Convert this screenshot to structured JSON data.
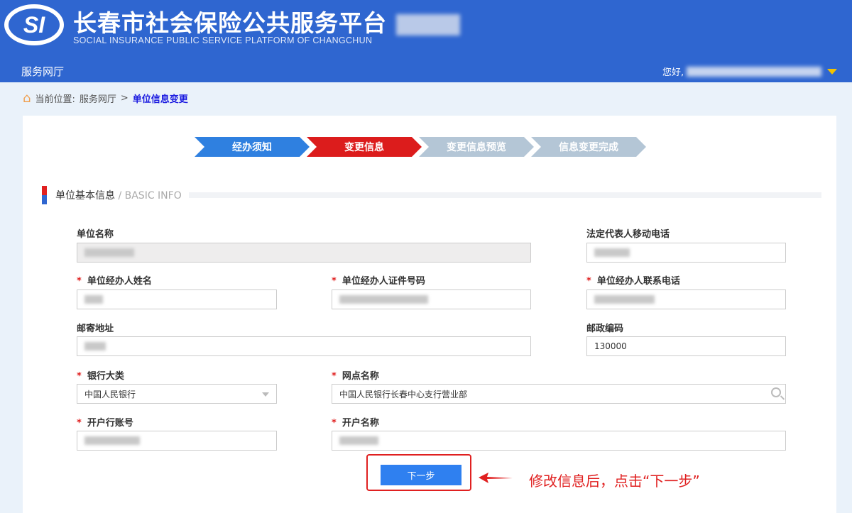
{
  "header": {
    "logo": "SI",
    "title": "长春市社会保险公共服务平台",
    "subtitle": "SOCIAL INSURANCE PUBLIC SERVICE PLATFORM OF CHANGCHUN",
    "nav_home": "服务网厅",
    "greeting": "您好,"
  },
  "breadcrumb": {
    "prefix": "当前位置:",
    "parent": "服务网厅",
    "separator": ">",
    "current": "单位信息变更"
  },
  "steps": [
    {
      "label": "经办须知",
      "color": "#2f80e0"
    },
    {
      "label": "变更信息",
      "color": "#dc1c1c"
    },
    {
      "label": "变更信息预览",
      "color": "#b4c6d6"
    },
    {
      "label": "信息变更完成",
      "color": "#b4c6d6"
    }
  ],
  "section": {
    "title": "单位基本信息",
    "subtitle": "/ BASIC INFO"
  },
  "form": {
    "required_mark": "*",
    "unit_name": {
      "label": "单位名称"
    },
    "legal_phone": {
      "label": "法定代表人移动电话"
    },
    "agent_name": {
      "label": "单位经办人姓名"
    },
    "agent_id": {
      "label": "单位经办人证件号码"
    },
    "agent_phone": {
      "label": "单位经办人联系电话"
    },
    "address": {
      "label": "邮寄地址"
    },
    "postcode": {
      "label": "邮政编码",
      "value": "130000"
    },
    "bank_type": {
      "label": "银行大类",
      "value": "中国人民银行"
    },
    "branch": {
      "label": "网点名称",
      "value": "中国人民银行长春中心支行营业部"
    },
    "account_no": {
      "label": "开户行账号"
    },
    "account_name": {
      "label": "开户名称"
    }
  },
  "next_button": "下一步",
  "annotation": "修改信息后，点击“下一步”"
}
